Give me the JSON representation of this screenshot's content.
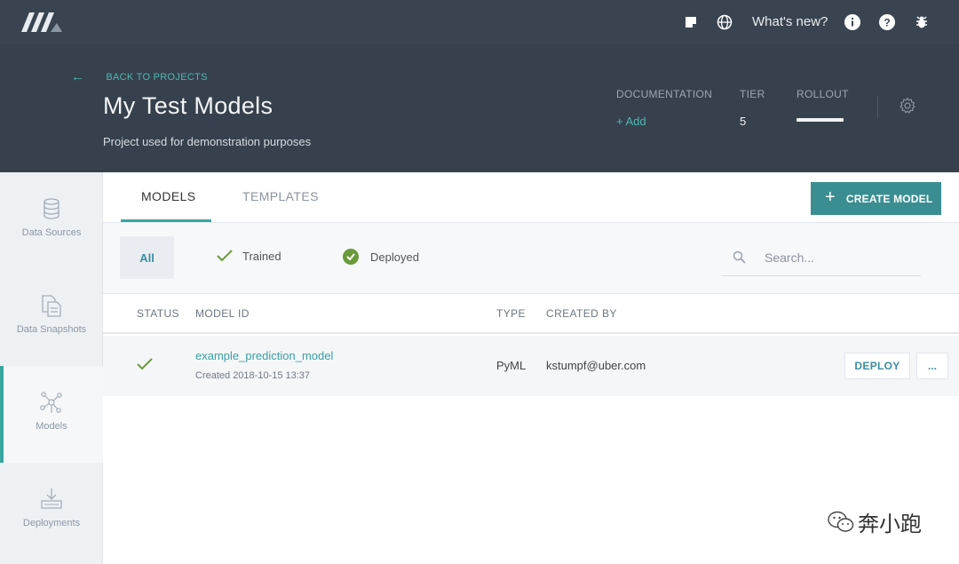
{
  "topbar": {
    "whats_new": "What's new?",
    "icons": [
      "logo-icon",
      "notes-icon",
      "globe-icon",
      "info-icon",
      "help-icon",
      "bug-icon"
    ]
  },
  "header": {
    "back_label": "BACK TO PROJECTS",
    "title": "My Test Models",
    "subtitle": "Project used for demonstration purposes",
    "documentation_label": "DOCUMENTATION",
    "documentation_value": "+ Add",
    "tier_label": "TIER",
    "tier_value": "5",
    "rollout_label": "ROLLOUT"
  },
  "sidebar": {
    "items": [
      {
        "label": "Data Sources",
        "icon": "database-icon"
      },
      {
        "label": "Data Snapshots",
        "icon": "snapshot-icon"
      },
      {
        "label": "Models",
        "icon": "network-icon",
        "active": true
      },
      {
        "label": "Deployments",
        "icon": "download-icon"
      }
    ]
  },
  "tabs": {
    "models": "MODELS",
    "templates": "TEMPLATES",
    "create_model": "CREATE MODEL"
  },
  "filters": {
    "all": "All",
    "trained": "Trained",
    "deployed": "Deployed",
    "search_placeholder": "Search..."
  },
  "table": {
    "headers": {
      "status": "STATUS",
      "model_id": "MODEL ID",
      "type": "TYPE",
      "created_by": "CREATED BY"
    },
    "rows": [
      {
        "model_id": "example_prediction_model",
        "created": "Created 2018-10-15 13:37",
        "type": "PyML",
        "created_by": "kstumpf@uber.com",
        "deploy": "DEPLOY",
        "more": "..."
      }
    ]
  },
  "watermark": {
    "text": "奔小跑"
  },
  "colors": {
    "accent": "#3aa6a0",
    "topbar": "#3a4450",
    "header": "#36414d",
    "check": "#6a9a3a"
  }
}
